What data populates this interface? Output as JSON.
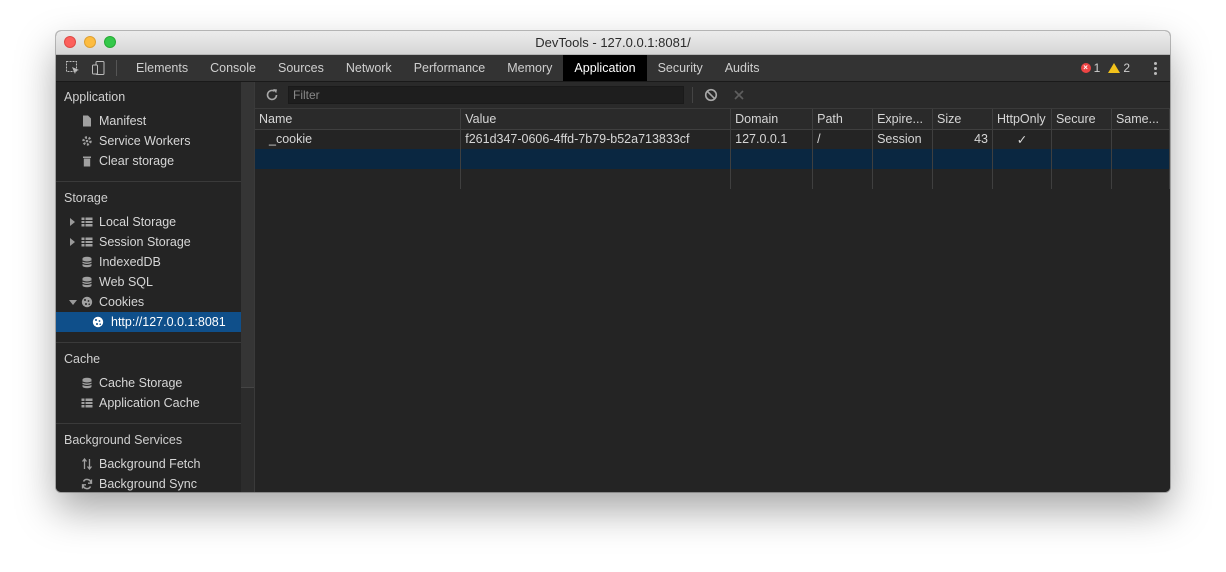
{
  "window": {
    "title": "DevTools - 127.0.0.1:8081/"
  },
  "tabbar": {
    "tabs": [
      "Elements",
      "Console",
      "Sources",
      "Network",
      "Performance",
      "Memory",
      "Application",
      "Security",
      "Audits"
    ],
    "active_tab": "Application",
    "error_count": "1",
    "warning_count": "2"
  },
  "sidebar": {
    "application": {
      "title": "Application",
      "items": [
        "Manifest",
        "Service Workers",
        "Clear storage"
      ]
    },
    "storage": {
      "title": "Storage",
      "items": [
        "Local Storage",
        "Session Storage",
        "IndexedDB",
        "Web SQL",
        "Cookies"
      ],
      "cookie_origin": "http://127.0.0.1:8081"
    },
    "cache": {
      "title": "Cache",
      "items": [
        "Cache Storage",
        "Application Cache"
      ]
    },
    "background": {
      "title": "Background Services",
      "items": [
        "Background Fetch",
        "Background Sync"
      ]
    }
  },
  "toolbar": {
    "filter_placeholder": "Filter",
    "filter_value": ""
  },
  "table": {
    "columns": [
      "Name",
      "Value",
      "Domain",
      "Path",
      "Expire...",
      "Size",
      "HttpOnly",
      "Secure",
      "Same..."
    ],
    "rows": [
      {
        "name": "_cookie",
        "value": "f261d347-0606-4ffd-7b79-b52a713833cf",
        "domain": "127.0.0.1",
        "path": "/",
        "expires": "Session",
        "size": "43",
        "httponly": "✓",
        "secure": "",
        "samesite": ""
      }
    ]
  },
  "colors": {
    "accent_selected": "#0f4f8a",
    "active_tab_bg": "#000000",
    "panel_bg": "#242424"
  }
}
